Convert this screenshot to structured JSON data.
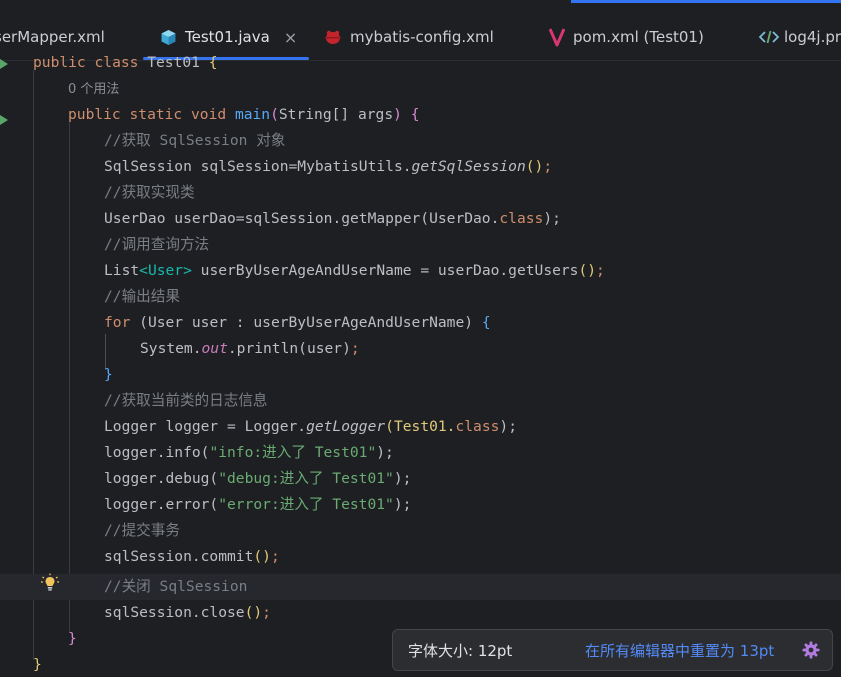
{
  "tabs": [
    {
      "label": "serMapper.xml",
      "icon": "xml-icon"
    },
    {
      "label": "Test01.java",
      "icon": "java-class-icon",
      "active": true,
      "close": "×"
    },
    {
      "label": "mybatis-config.xml",
      "icon": "mybatis-icon"
    },
    {
      "label": "pom.xml (Test01)",
      "icon": "maven-icon"
    },
    {
      "label": "log4j.pr",
      "icon": "code-tag-icon"
    }
  ],
  "code": {
    "l0_a": "public class ",
    "l0_b": "Test01 ",
    "l0_c": "{",
    "usages": "0 个用法",
    "l2_kw": "public static void ",
    "l2_fn": "main",
    "l2_p1": "(",
    "l2_args": "String[] args",
    "l2_p2": ") ",
    "l2_br": "{",
    "c1": "//获取 SqlSession 对象",
    "l4_a": "SqlSession sqlSession=MybatisUtils.",
    "l4_b": "getSqlSession",
    "l4_c": "()",
    "l4_d": ";",
    "c2": "//获取实现类",
    "l6_a": "UserDao userDao=sqlSession.getMapper(UserDao.",
    "l6_b": "class",
    "l6_c": ");",
    "c3": "//调用查询方法",
    "l8_a": "List",
    "l8_b": "<User>",
    "l8_c": " userByUserAgeAndUserName = userDao.getUsers",
    "l8_d": "()",
    "l8_e": ";",
    "c4": "//输出结果",
    "l10_kw": "for ",
    "l10_a": "(User user : userByUserAgeAndUserName) ",
    "l10_br": "{",
    "l11_a": "System.",
    "l11_b": "out",
    "l11_c": ".println(user)",
    "l11_d": ";",
    "l12_br": "}",
    "c5": "//获取当前类的日志信息",
    "l14_a": "Logger logger = Logger.",
    "l14_b": "getLogger",
    "l14_c": "(Test01.",
    "l14_d": "class",
    "l14_e": ");",
    "l15_a": "logger.info(",
    "l15_s": "\"info:进入了 Test01\"",
    "l15_e": ");",
    "l16_a": "logger.debug(",
    "l16_s": "\"debug:进入了 Test01\"",
    "l16_e": ");",
    "l17_a": "logger.error(",
    "l17_s": "\"error:进入了 Test01\"",
    "l17_e": ");",
    "c6": "//提交事务",
    "l19_a": "sqlSession.commit",
    "l19_b": "()",
    "l19_c": ";",
    "c7": "//关闭 SqlSession",
    "l21_a": "sqlSession.close",
    "l21_b": "()",
    "l21_c": ";",
    "l22_br": "}",
    "l23_br": "}"
  },
  "popup": {
    "font_size_label": "字体大小: 12pt",
    "reset_link": "在所有编辑器中重置为 13pt",
    "settings_icon": "gear-icon"
  },
  "colors": {
    "accent": "#3574f0",
    "keyword": "#cf8e6d",
    "function": "#56a8f5",
    "string": "#6aab73",
    "comment": "#7a7e85"
  }
}
